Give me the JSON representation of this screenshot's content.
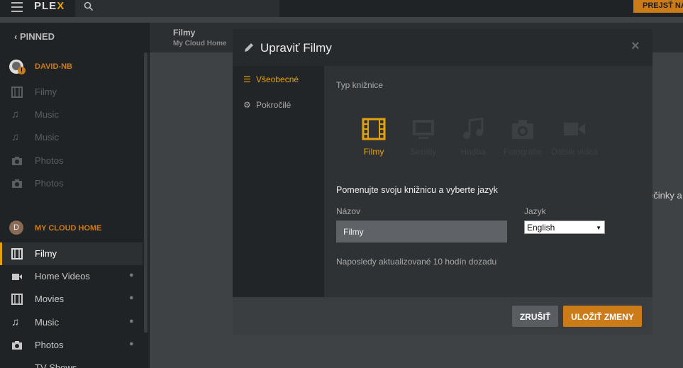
{
  "topbar": {
    "logo_text": "PLE",
    "logo_x": "X",
    "premium_label": "PREJSŤ NA"
  },
  "sidebar": {
    "pinned_label": "PINNED",
    "server1": {
      "name": "DAVID-NB",
      "items": [
        "Filmy",
        "Music",
        "Music",
        "Photos",
        "Photos"
      ]
    },
    "server2": {
      "name": "MY CLOUD HOME",
      "avatar_letter": "D",
      "items": [
        "Filmy",
        "Home Videos",
        "Movies",
        "Music",
        "Photos",
        "TV Shows"
      ]
    }
  },
  "main": {
    "title": "Filmy",
    "subtitle": "My Cloud Home",
    "side_text": "ečinky a"
  },
  "modal": {
    "title": "Upraviť Filmy",
    "close_symbol": "×",
    "tabs": [
      "Všeobecné",
      "Pokročilé"
    ],
    "type_label": "Typ knižnice",
    "types": [
      "Filmy",
      "Seriály",
      "Hudba",
      "Fotografie",
      "Ďalšie videá"
    ],
    "name_section_label": "Pomenujte svoju knižnicu a vyberte jazyk",
    "name_label": "Názov",
    "name_value": "Filmy",
    "language_label": "Jazyk",
    "language_value": "English",
    "updated_text": "Naposledy aktualizované 10 hodín dozadu",
    "cancel_label": "ZRUŠIŤ",
    "save_label": "ULOŽIŤ ZMENY"
  },
  "colors": {
    "accent": "#e5a00d",
    "save": "#cc7b19"
  }
}
